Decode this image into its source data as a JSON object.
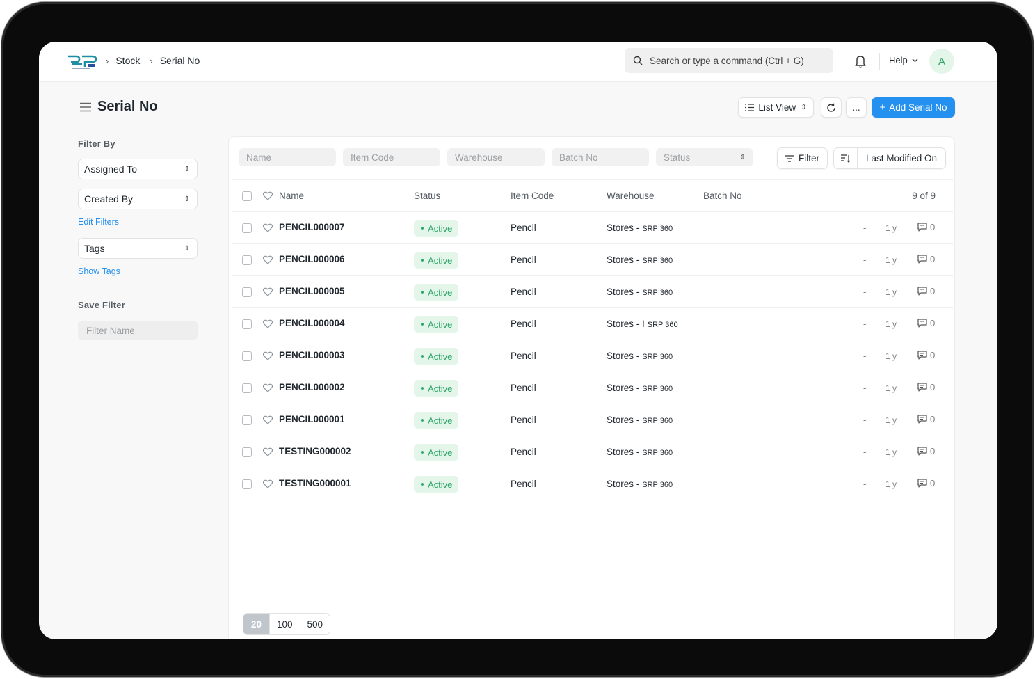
{
  "navbar": {
    "breadcrumbs": [
      "Stock",
      "Serial No"
    ],
    "search_placeholder": "Search or type a command (Ctrl + G)",
    "help_label": "Help",
    "avatar_initial": "A"
  },
  "page": {
    "title": "Serial No",
    "list_view_label": "List View",
    "more_label": "...",
    "add_label": "Add Serial No",
    "accent_color": "#2490ef"
  },
  "sidebar": {
    "filter_by_label": "Filter By",
    "assigned_to": "Assigned To",
    "created_by": "Created By",
    "edit_filters": "Edit Filters",
    "tags": "Tags",
    "show_tags": "Show Tags",
    "save_filter_label": "Save Filter",
    "filter_name_placeholder": "Filter Name"
  },
  "filters": {
    "name": "Name",
    "item_code": "Item Code",
    "warehouse": "Warehouse",
    "batch_no": "Batch No",
    "status": "Status",
    "filter_button": "Filter",
    "sort_label": "Last Modified On"
  },
  "table": {
    "headers": {
      "name": "Name",
      "status": "Status",
      "item_code": "Item Code",
      "warehouse": "Warehouse",
      "batch_no": "Batch No",
      "count": "9 of 9"
    },
    "rows": [
      {
        "name": "PENCIL000007",
        "status": "Active",
        "item": "Pencil",
        "wh": "Stores -",
        "wh_suffix": "SRP 360",
        "dash": "-",
        "time": "1 y",
        "comments": "0"
      },
      {
        "name": "PENCIL000006",
        "status": "Active",
        "item": "Pencil",
        "wh": "Stores -",
        "wh_suffix": "SRP 360",
        "dash": "-",
        "time": "1 y",
        "comments": "0"
      },
      {
        "name": "PENCIL000005",
        "status": "Active",
        "item": "Pencil",
        "wh": "Stores -",
        "wh_suffix": "SRP 360",
        "dash": "-",
        "time": "1 y",
        "comments": "0"
      },
      {
        "name": "PENCIL000004",
        "status": "Active",
        "item": "Pencil",
        "wh": "Stores - I",
        "wh_suffix": "SRP 360",
        "dash": "-",
        "time": "1 y",
        "comments": "0"
      },
      {
        "name": "PENCIL000003",
        "status": "Active",
        "item": "Pencil",
        "wh": "Stores -",
        "wh_suffix": "SRP 360",
        "dash": "-",
        "time": "1 y",
        "comments": "0"
      },
      {
        "name": "PENCIL000002",
        "status": "Active",
        "item": "Pencil",
        "wh": "Stores -",
        "wh_suffix": "SRP 360",
        "dash": "-",
        "time": "1 y",
        "comments": "0"
      },
      {
        "name": "PENCIL000001",
        "status": "Active",
        "item": "Pencil",
        "wh": "Stores -",
        "wh_suffix": "SRP 360",
        "dash": "-",
        "time": "1 y",
        "comments": "0"
      },
      {
        "name": "TESTING000002",
        "status": "Active",
        "item": "Pencil",
        "wh": "Stores -",
        "wh_suffix": "SRP 360",
        "dash": "-",
        "time": "1 y",
        "comments": "0"
      },
      {
        "name": "TESTING000001",
        "status": "Active",
        "item": "Pencil",
        "wh": "Stores -",
        "wh_suffix": "SRP 360",
        "dash": "-",
        "time": "1 y",
        "comments": "0"
      }
    ]
  },
  "pager": {
    "sizes": [
      "20",
      "100",
      "500"
    ],
    "selected": "20"
  }
}
